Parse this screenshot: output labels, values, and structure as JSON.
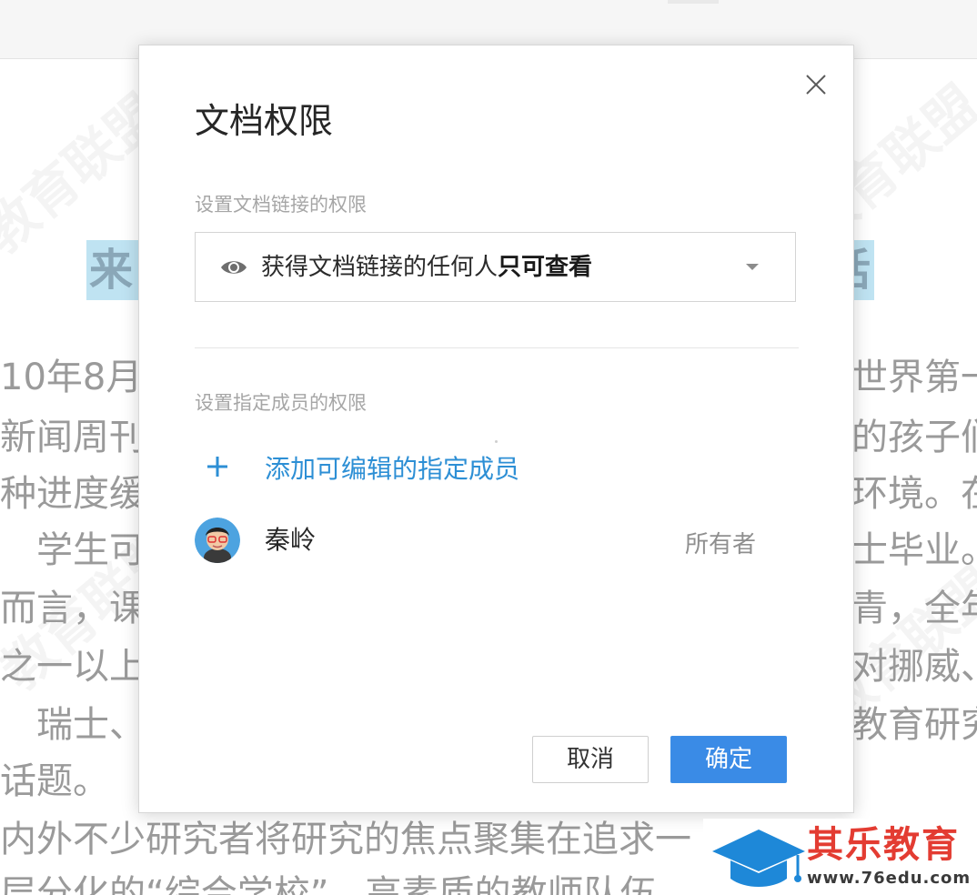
{
  "background_doc": {
    "title_left": "来",
    "title_right": "话",
    "lines": [
      {
        "left": "10年8月",
        "right": "世界第一"
      },
      {
        "left": "新闻周刊",
        "right": "的孩子们"
      },
      {
        "left": "种进度缓",
        "right": "环境。在"
      },
      {
        "left": "　学生可",
        "right": "士毕业。"
      },
      {
        "left": "而言，课",
        "right": "青，全年"
      },
      {
        "left": "之一以上",
        "right": "对挪威、"
      },
      {
        "left": "　瑞士、",
        "right": "教育研究"
      },
      {
        "left": "话题。",
        "right": ""
      },
      {
        "left": "内外不少研究者将研究的焦点聚集在追求一",
        "right": ""
      },
      {
        "left": "层分化的“综合学校”、高素质的教师队伍",
        "right": ""
      }
    ]
  },
  "dialog": {
    "title": "文档权限",
    "close_icon": "close-icon",
    "link_section_label": "设置文档链接的权限",
    "link_permission": {
      "icon": "eye-icon",
      "prefix": "获得文档链接的任何人",
      "emphasis": "只可查看"
    },
    "members_section_label": "设置指定成员的权限",
    "add_member_label": "添加可编辑的指定成员",
    "members": [
      {
        "name": "秦岭",
        "role": "所有者",
        "avatar": "avatar-icon"
      }
    ],
    "cancel_label": "取消",
    "confirm_label": "确定"
  },
  "brand": {
    "name": "其乐教育",
    "url": "www.76edu.com"
  },
  "colors": {
    "accent": "#2d8fd5",
    "confirm_button": "#3a8be6",
    "brand_red": "#e33c32",
    "brand_blue": "#1e88d8"
  }
}
